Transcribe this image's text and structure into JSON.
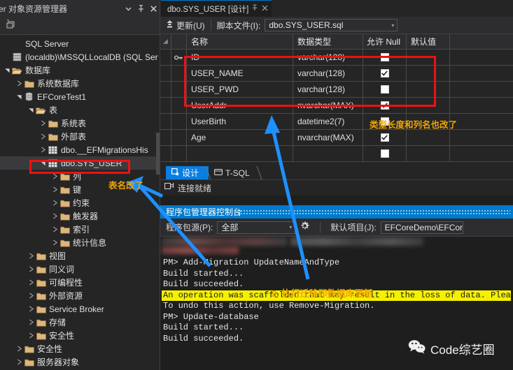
{
  "sidebar": {
    "title": "ver 对象资源管理器",
    "header_buttons": [
      "chevron-down",
      "pin",
      "close"
    ],
    "toolbar_icon": "new-query-icon",
    "items": [
      {
        "label": "SQL Server",
        "depth": 0,
        "twist": "none",
        "icon": "none"
      },
      {
        "label": "(localdb)\\MSSQLLocalDB (SQL Ser",
        "depth": 0,
        "twist": "none",
        "icon": "server"
      },
      {
        "label": "数据库",
        "depth": 0,
        "twist": "open",
        "icon": "folder-open"
      },
      {
        "label": "系统数据库",
        "depth": 1,
        "twist": "closed",
        "icon": "folder"
      },
      {
        "label": "EFCoreTest1",
        "depth": 1,
        "twist": "open",
        "icon": "database"
      },
      {
        "label": "表",
        "depth": 2,
        "twist": "open",
        "icon": "folder-open"
      },
      {
        "label": "系统表",
        "depth": 3,
        "twist": "closed",
        "icon": "folder"
      },
      {
        "label": "外部表",
        "depth": 3,
        "twist": "closed",
        "icon": "folder"
      },
      {
        "label": "dbo.__EFMigrationsHis",
        "depth": 3,
        "twist": "closed",
        "icon": "table"
      },
      {
        "label": "dbo.SYS_USER",
        "depth": 3,
        "twist": "open",
        "icon": "table",
        "selected": true
      },
      {
        "label": "列",
        "depth": 4,
        "twist": "closed",
        "icon": "folder"
      },
      {
        "label": "键",
        "depth": 4,
        "twist": "closed",
        "icon": "folder"
      },
      {
        "label": "约束",
        "depth": 4,
        "twist": "closed",
        "icon": "folder"
      },
      {
        "label": "触发器",
        "depth": 4,
        "twist": "closed",
        "icon": "folder"
      },
      {
        "label": "索引",
        "depth": 4,
        "twist": "closed",
        "icon": "folder"
      },
      {
        "label": "统计信息",
        "depth": 4,
        "twist": "closed",
        "icon": "folder"
      },
      {
        "label": "视图",
        "depth": 2,
        "twist": "closed",
        "icon": "folder"
      },
      {
        "label": "同义词",
        "depth": 2,
        "twist": "closed",
        "icon": "folder"
      },
      {
        "label": "可编程性",
        "depth": 2,
        "twist": "closed",
        "icon": "folder"
      },
      {
        "label": "外部资源",
        "depth": 2,
        "twist": "closed",
        "icon": "folder"
      },
      {
        "label": "Service Broker",
        "depth": 2,
        "twist": "closed",
        "icon": "folder"
      },
      {
        "label": "存储",
        "depth": 2,
        "twist": "closed",
        "icon": "folder"
      },
      {
        "label": "安全性",
        "depth": 2,
        "twist": "closed",
        "icon": "folder"
      },
      {
        "label": "安全性",
        "depth": 1,
        "twist": "closed",
        "icon": "folder"
      },
      {
        "label": "服务器对象",
        "depth": 1,
        "twist": "closed",
        "icon": "folder"
      }
    ]
  },
  "editor": {
    "tab_label": "dbo.SYS_USER [设计]",
    "toolbar": {
      "update_label": "更新(U)",
      "script_file_label": "脚本文件(I):",
      "script_file_value": "dbo.SYS_USER.sql"
    },
    "grid": {
      "columns": [
        "名称",
        "数据类型",
        "允许 Null",
        "默认值"
      ],
      "rows": [
        {
          "key": true,
          "name": "ID",
          "type": "varchar(128)",
          "null": false,
          "default": ""
        },
        {
          "key": false,
          "name": "USER_NAME",
          "type": "varchar(128)",
          "null": true,
          "default": ""
        },
        {
          "key": false,
          "name": "USER_PWD",
          "type": "varchar(128)",
          "null": false,
          "default": ""
        },
        {
          "key": false,
          "name": "UserAddr",
          "type": "nvarchar(MAX)",
          "null": true,
          "default": ""
        },
        {
          "key": false,
          "name": "UserBirth",
          "type": "datetime2(7)",
          "null": false,
          "default": ""
        },
        {
          "key": false,
          "name": "Age",
          "type": "nvarchar(MAX)",
          "null": true,
          "default": ""
        },
        {
          "key": false,
          "name": "",
          "type": "",
          "null": false,
          "default": ""
        }
      ]
    },
    "view_tabs": [
      {
        "label": "设计",
        "active": true
      },
      {
        "label": "T-SQL",
        "active": false
      }
    ],
    "status": "连接就绪"
  },
  "console": {
    "title": "程序包管理器控制台",
    "source_label": "程序包源(P):",
    "source_value": "全部",
    "settings_icon": "gear-icon",
    "project_label": "默认项目(J):",
    "project_value": "EFCoreDemo\\EFCoreT",
    "lines": [
      {
        "text": "PM> Add-Migration UpdateNameAndType",
        "style": "normal"
      },
      {
        "text": "Build started...",
        "style": "normal"
      },
      {
        "text": "Build succeeded.",
        "style": "normal"
      },
      {
        "text": "An operation was scaffolded that may result in the loss of data. Plea",
        "style": "highlight"
      },
      {
        "text": "To undo this action, use Remove-Migration.",
        "style": "normal"
      },
      {
        "text": "PM> Update-database",
        "style": "normal"
      },
      {
        "text": "Build started...",
        "style": "normal"
      },
      {
        "text": "Build succeeded.",
        "style": "normal"
      }
    ]
  },
  "annotations": {
    "table_renamed": "表名改了",
    "type_and_column_changed": "类型长度和列名也改了",
    "run_migration": "2. 执行迁移即数据库更新"
  },
  "watermark": {
    "icon": "wechat-icon",
    "label": "Code综艺圈"
  },
  "colors": {
    "accent": "#007acc",
    "annotation": "#f0a500",
    "redbox": "#ee1111",
    "arrow": "#1e90ff",
    "highlight": "#f5f000"
  }
}
